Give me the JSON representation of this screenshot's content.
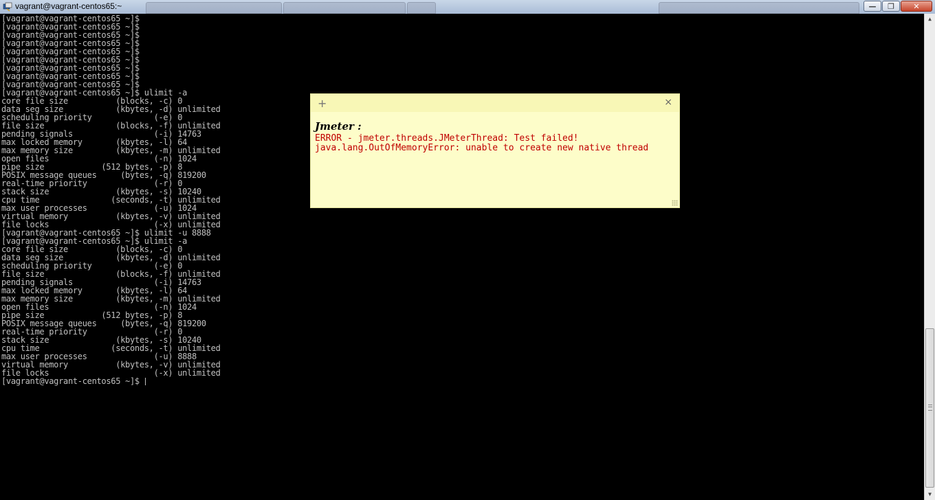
{
  "window": {
    "title": "vagrant@vagrant-centos65:~",
    "min_glyph": "—",
    "max_glyph": "❐",
    "close_glyph": "✕",
    "icon": "putty-terminal-icon"
  },
  "terminal": {
    "lines": [
      "[vagrant@vagrant-centos65 ~]$",
      "[vagrant@vagrant-centos65 ~]$",
      "[vagrant@vagrant-centos65 ~]$",
      "[vagrant@vagrant-centos65 ~]$",
      "[vagrant@vagrant-centos65 ~]$",
      "[vagrant@vagrant-centos65 ~]$",
      "[vagrant@vagrant-centos65 ~]$",
      "[vagrant@vagrant-centos65 ~]$",
      "[vagrant@vagrant-centos65 ~]$",
      "[vagrant@vagrant-centos65 ~]$ ulimit -a",
      "core file size          (blocks, -c) 0",
      "data seg size           (kbytes, -d) unlimited",
      "scheduling priority             (-e) 0",
      "file size               (blocks, -f) unlimited",
      "pending signals                 (-i) 14763",
      "max locked memory       (kbytes, -l) 64",
      "max memory size         (kbytes, -m) unlimited",
      "open files                      (-n) 1024",
      "pipe size            (512 bytes, -p) 8",
      "POSIX message queues     (bytes, -q) 819200",
      "real-time priority              (-r) 0",
      "stack size              (kbytes, -s) 10240",
      "cpu time               (seconds, -t) unlimited",
      "max user processes              (-u) 1024",
      "virtual memory          (kbytes, -v) unlimited",
      "file locks                      (-x) unlimited",
      "[vagrant@vagrant-centos65 ~]$ ulimit -u 8888",
      "[vagrant@vagrant-centos65 ~]$ ulimit -a",
      "core file size          (blocks, -c) 0",
      "data seg size           (kbytes, -d) unlimited",
      "scheduling priority             (-e) 0",
      "file size               (blocks, -f) unlimited",
      "pending signals                 (-i) 14763",
      "max locked memory       (kbytes, -l) 64",
      "max memory size         (kbytes, -m) unlimited",
      "open files                      (-n) 1024",
      "pipe size            (512 bytes, -p) 8",
      "POSIX message queues     (bytes, -q) 819200",
      "real-time priority              (-r) 0",
      "stack size              (kbytes, -s) 10240",
      "cpu time               (seconds, -t) unlimited",
      "max user processes              (-u) 8888",
      "virtual memory          (kbytes, -v) unlimited",
      "file locks                      (-x) unlimited"
    ],
    "prompt": "[vagrant@vagrant-centos65 ~]$ ",
    "text_color": "#c0c0c0",
    "background": "#000000"
  },
  "scrollbar": {
    "up_glyph": "▲",
    "down_glyph": "▼"
  },
  "sticky_note": {
    "add_glyph": "+",
    "close_glyph": "×",
    "title": "Jmeter :",
    "lines": [
      "ERROR - jmeter.threads.JMeterThread: Test failed!",
      "java.lang.OutOfMemoryError: unable to create new native thread"
    ],
    "background": "#fdfdc9",
    "text_color": "#c00000"
  }
}
